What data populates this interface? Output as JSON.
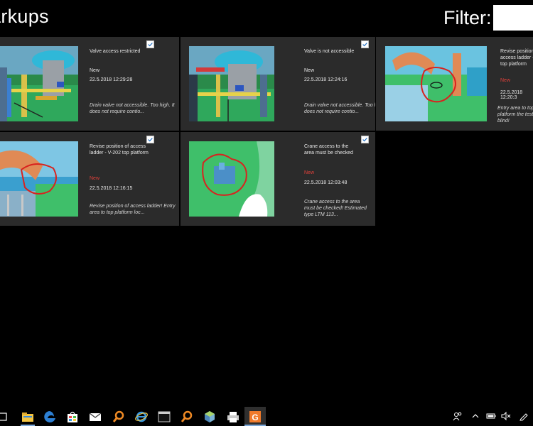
{
  "header": {
    "title": "arkups",
    "filter_label": "Filter:",
    "filter_value": ""
  },
  "cards": [
    {
      "title": "Valve access restricted",
      "status": "New",
      "status_color": "#e8e8e8",
      "date": "22.5.2018 12:29:28",
      "description": "Drain valve not accessible. Too high. It does not require contio...",
      "checked": true
    },
    {
      "title": "Valve is not accessible",
      "status": "New",
      "status_color": "#e8e8e8",
      "date": "22.5.2018 12:24:16",
      "description": "Drain valve not accessible. Too high. It does not require contio...",
      "checked": true
    },
    {
      "title": "Revise position of access ladder - V top platform",
      "status": "New",
      "status_color": "#e0403a",
      "date": "22.5.2018 12:20:3",
      "description": "Entry area to top platform the test blind!",
      "checked": false
    },
    {
      "title": "Revise position of access ladder - V-202 top platform",
      "status": "New",
      "status_color": "#e0403a",
      "date": "22.5.2018 12:16:15",
      "description": "Revise position of access ladder! Entry area to top platform loc...",
      "checked": true
    },
    {
      "title": "Crane access to the area must be checked",
      "status": "New",
      "status_color": "#e0403a",
      "date": "22.5.2018 12:03:48",
      "description": "Crane access to the area must be checked! Estimated type LTM 113...",
      "checked": true
    }
  ],
  "taskbar": {
    "icons": [
      "task-view-icon",
      "file-explorer-icon",
      "edge-icon",
      "store-icon",
      "mail-icon",
      "search-app-icon",
      "internet-explorer-icon",
      "terminal-icon",
      "search-app-2-icon",
      "app-cube-icon",
      "printer-icon",
      "markup-app-icon"
    ],
    "tray": [
      "people-icon",
      "chevron-up-icon",
      "battery-icon",
      "speaker-mute-icon",
      "pen-icon"
    ]
  },
  "colors": {
    "background": "#000000",
    "card": "#2b2b2b",
    "accent_red": "#e0403a",
    "taskbar_underline": "#7aa7d9"
  }
}
